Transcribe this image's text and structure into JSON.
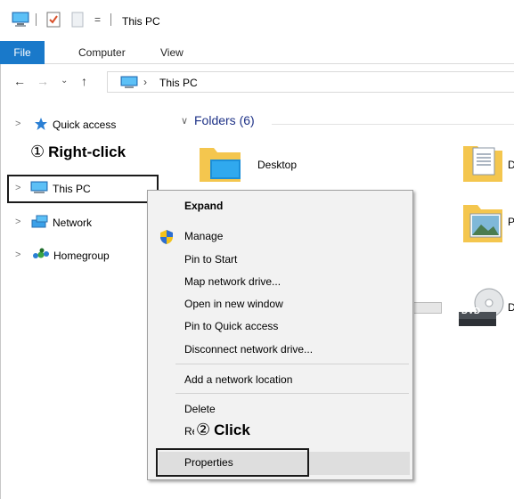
{
  "window": {
    "title": "This PC",
    "qa_dropdown_glyph": "="
  },
  "ribbon": {
    "tabs": [
      "File",
      "Computer",
      "View"
    ]
  },
  "address": {
    "path_sep": "›",
    "location": "This PC"
  },
  "nav_pane": {
    "items": [
      {
        "label": "Quick access",
        "icon": "star-icon"
      },
      {
        "label": "This PC",
        "icon": "computer-icon"
      },
      {
        "label": "Network",
        "icon": "network-icon"
      },
      {
        "label": "Homegroup",
        "icon": "homegroup-icon"
      }
    ]
  },
  "content": {
    "folders_heading": "Folders (6)",
    "folders": [
      {
        "label": "Desktop",
        "icon": "desktop-folder-icon"
      },
      {
        "label": "D",
        "icon": "documents-folder-icon"
      },
      {
        "label": "P",
        "icon": "pictures-folder-icon"
      },
      {
        "label": "D",
        "icon": "dvd-drive-icon"
      }
    ],
    "dvd_badge": "DVD"
  },
  "context_menu": {
    "items": [
      {
        "label": "Expand",
        "bold": true
      },
      {
        "label": "Manage",
        "icon": "shield-icon"
      },
      {
        "label": "Pin to Start"
      },
      {
        "label": "Map network drive..."
      },
      {
        "label": "Open in new window"
      },
      {
        "label": "Pin to Quick access"
      },
      {
        "label": "Disconnect network drive..."
      },
      {
        "label": "Add a network location"
      },
      {
        "label": "Delete"
      },
      {
        "label": "Rename"
      },
      {
        "label": "Properties"
      }
    ]
  },
  "annotations": {
    "step1_num": "①",
    "step1_text": "Right-click",
    "step2_num": "②",
    "step2_text": "Click"
  },
  "colors": {
    "file_tab": "#1979ca",
    "folders_heading": "#1e3287",
    "menu_bg": "#f2f2f2"
  }
}
